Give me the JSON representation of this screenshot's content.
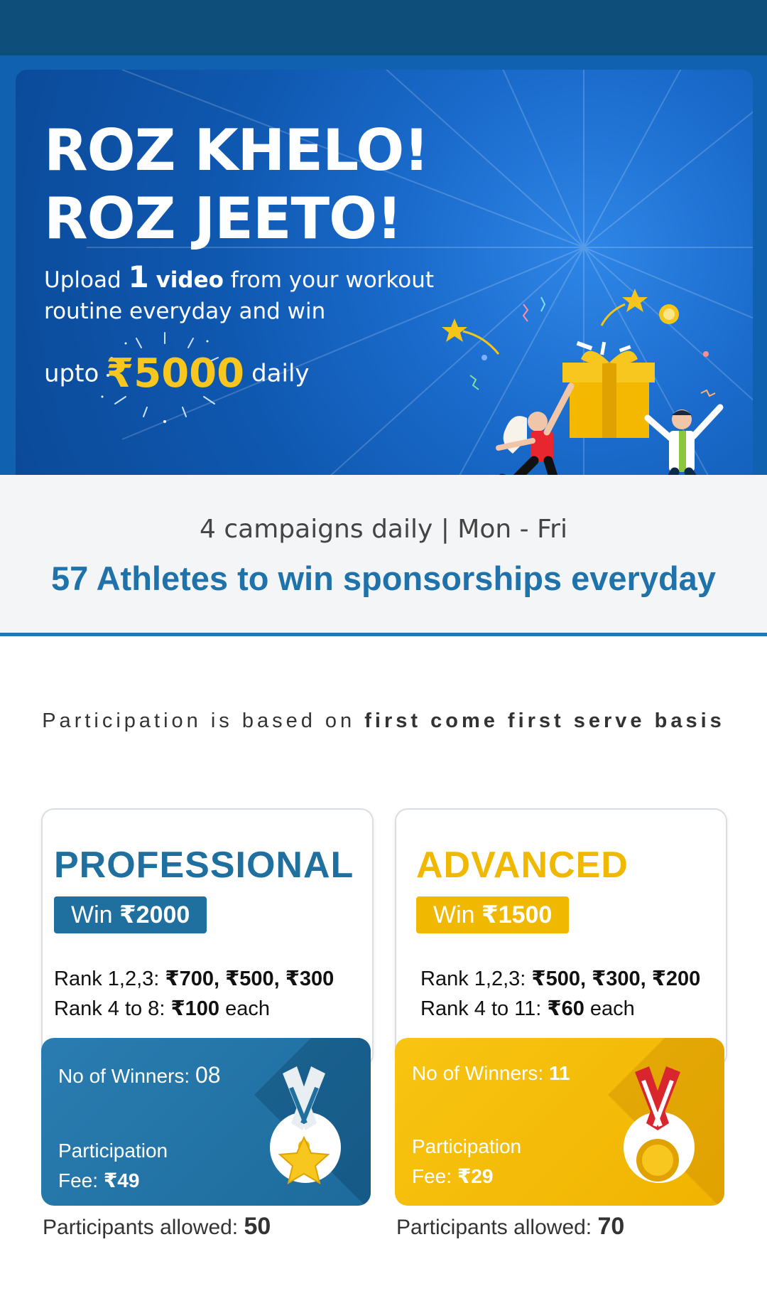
{
  "hero": {
    "title_line1": "ROZ KHELO!",
    "title_line2": "ROZ JEETO!",
    "sub_pre": "Upload",
    "sub_num": "1",
    "sub_bold": "video",
    "sub_post": "from your workout routine everyday and win",
    "prize_pre": "upto",
    "prize_amount": "₹5000",
    "prize_post": "daily"
  },
  "info": {
    "campaigns": "4 campaigns daily | Mon - Fri",
    "athletes": "57 Athletes to win sponsorships everyday"
  },
  "basis": {
    "pre": "Participation is based on",
    "bold": "first come first serve basis"
  },
  "plans": [
    {
      "title": "PROFESSIONAL",
      "win_pre": "Win",
      "win_amount": "₹2000",
      "rank1_label": "Rank 1,2,3:",
      "rank1_values": "₹700, ₹500, ₹300",
      "rank2_label": "Rank 4 to 8:",
      "rank2_value": "₹100",
      "rank2_suffix": "each",
      "winners_label": "No of Winners:",
      "winners_value": "08",
      "fee_line1": "Participation",
      "fee_label": "Fee:",
      "fee_value": "₹49",
      "allowed_label": "Participants allowed:",
      "allowed_value": "50",
      "color": "#1f6f9f",
      "medal": "star-medal-icon"
    },
    {
      "title": "ADVANCED",
      "win_pre": "Win",
      "win_amount": "₹1500",
      "rank1_label": "Rank 1,2,3:",
      "rank1_values": "₹500, ₹300, ₹200",
      "rank2_label": "Rank 4 to 11:",
      "rank2_value": "₹60",
      "rank2_suffix": "each",
      "winners_label": "No of Winners:",
      "winners_value": "11",
      "fee_line1": "Participation",
      "fee_label": "Fee:",
      "fee_value": "₹29",
      "allowed_label": "Participants allowed:",
      "allowed_value": "70",
      "color": "#f0b800",
      "medal": "gold-medal-icon"
    }
  ]
}
